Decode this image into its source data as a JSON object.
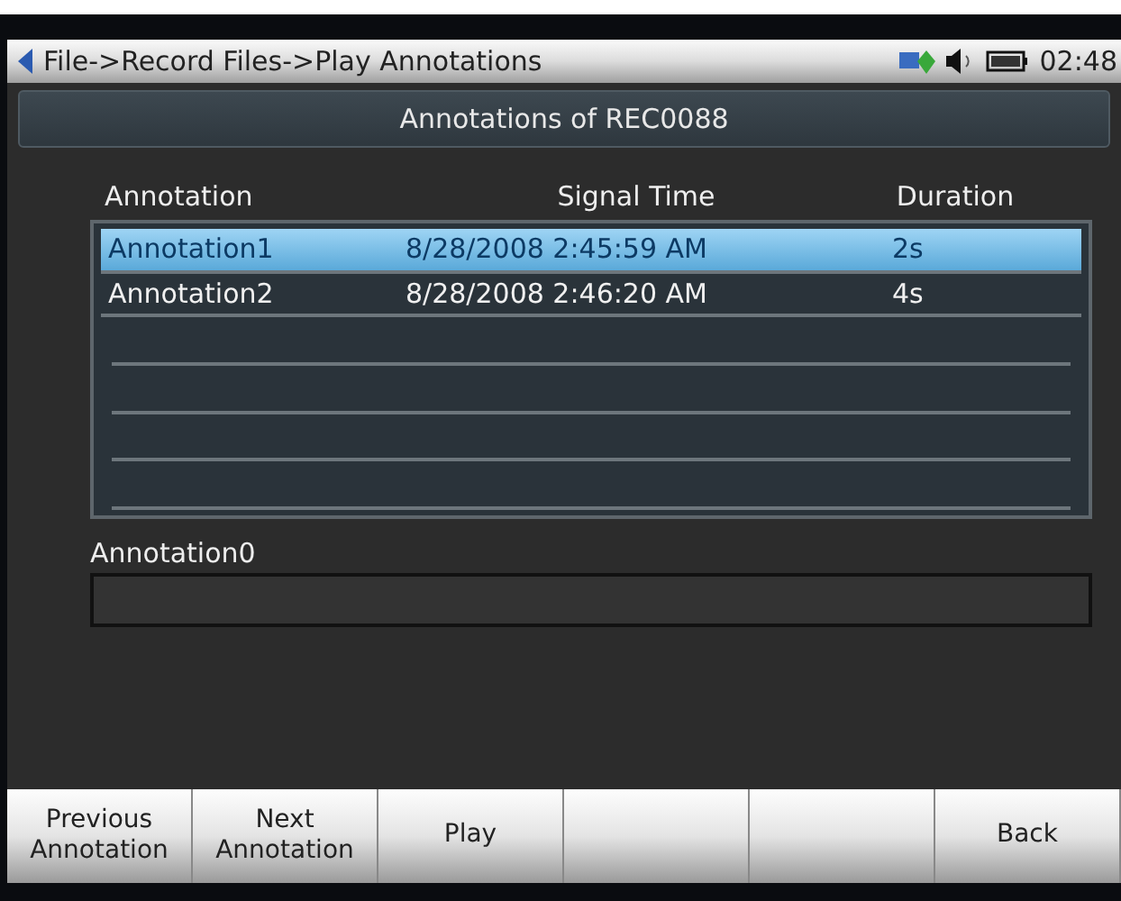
{
  "title_bar": {
    "breadcrumb": "File->Record Files->Play Annotations",
    "time": "02:48"
  },
  "header": {
    "title": "Annotations of REC0088"
  },
  "table": {
    "columns": [
      "Annotation",
      "Signal Time",
      "Duration"
    ],
    "rows": [
      {
        "cells": [
          "Annotation1",
          "8/28/2008 2:45:59 AM",
          "2s"
        ],
        "selected": true
      },
      {
        "cells": [
          "Annotation2",
          "8/28/2008 2:46:20 AM",
          "4s"
        ],
        "selected": false
      }
    ]
  },
  "note": {
    "label": "Annotation0"
  },
  "softkeys": [
    {
      "kind": "label",
      "lines": [
        "Previous",
        "Annotation"
      ]
    },
    {
      "kind": "label",
      "lines": [
        "Next",
        "Annotation"
      ]
    },
    {
      "kind": "label",
      "lines": [
        "Play"
      ]
    },
    {
      "kind": "blank"
    },
    {
      "kind": "blank"
    },
    {
      "kind": "label",
      "lines": [
        "Back"
      ]
    }
  ]
}
